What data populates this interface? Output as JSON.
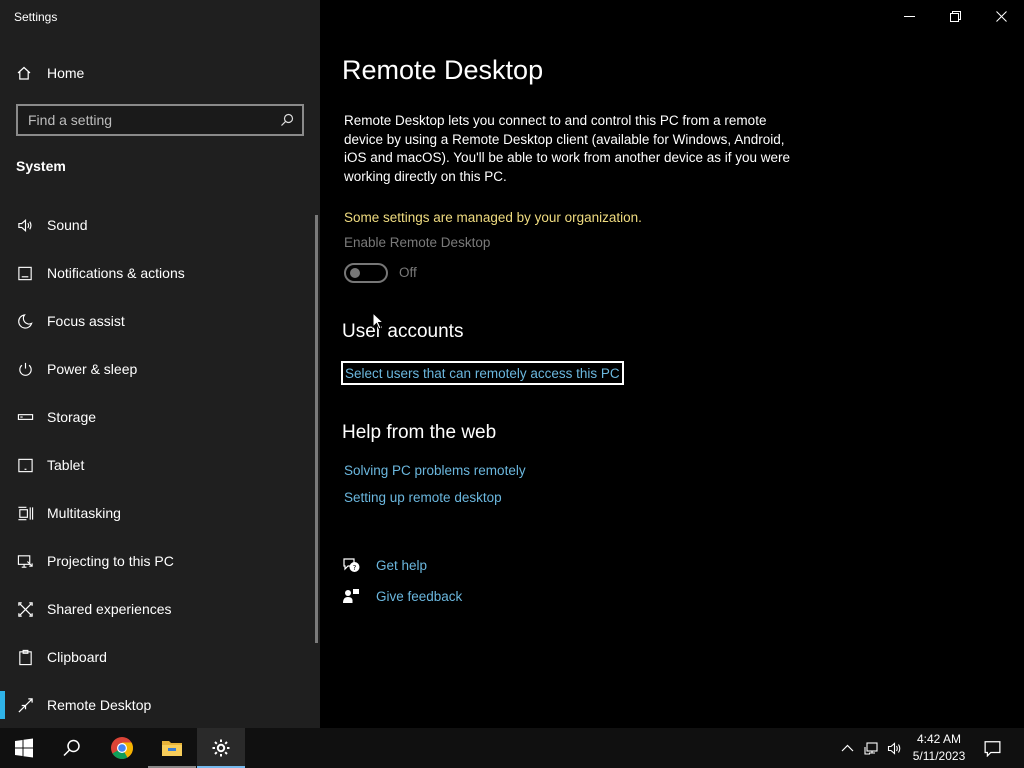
{
  "app": {
    "title": "Settings"
  },
  "sidebar": {
    "home_label": "Home",
    "search_placeholder": "Find a setting",
    "section_title": "System",
    "items": [
      {
        "label": "Sound",
        "icon": "speaker-icon",
        "active": false
      },
      {
        "label": "Notifications & actions",
        "icon": "notification-icon",
        "active": false
      },
      {
        "label": "Focus assist",
        "icon": "moon-icon",
        "active": false
      },
      {
        "label": "Power & sleep",
        "icon": "power-icon",
        "active": false
      },
      {
        "label": "Storage",
        "icon": "storage-icon",
        "active": false
      },
      {
        "label": "Tablet",
        "icon": "tablet-icon",
        "active": false
      },
      {
        "label": "Multitasking",
        "icon": "multitasking-icon",
        "active": false
      },
      {
        "label": "Projecting to this PC",
        "icon": "projecting-icon",
        "active": false
      },
      {
        "label": "Shared experiences",
        "icon": "shared-experiences-icon",
        "active": false
      },
      {
        "label": "Clipboard",
        "icon": "clipboard-icon",
        "active": false
      },
      {
        "label": "Remote Desktop",
        "icon": "remote-desktop-icon",
        "active": true
      }
    ]
  },
  "main": {
    "title": "Remote Desktop",
    "description": "Remote Desktop lets you connect to and control this PC from a remote device by using a Remote Desktop client (available for Windows, Android, iOS and macOS). You'll be able to work from another device as if you were working directly on this PC.",
    "managed_notice": "Some settings are managed by your organization.",
    "enable_label": "Enable Remote Desktop",
    "toggle_state": "Off",
    "user_accounts_title": "User accounts",
    "select_users_link": "Select users that can remotely access this PC",
    "help_title": "Help from the web",
    "help_links": [
      "Solving PC problems remotely",
      "Setting up remote desktop"
    ],
    "get_help": "Get help",
    "give_feedback": "Give feedback"
  },
  "taskbar": {
    "time": "4:42 AM",
    "date": "5/11/2023"
  },
  "colors": {
    "accent": "#2fb3e8",
    "link": "#6bb7de",
    "warning": "#f0dc80",
    "sidebar_bg": "#1f1f1f",
    "main_bg": "#000000"
  }
}
